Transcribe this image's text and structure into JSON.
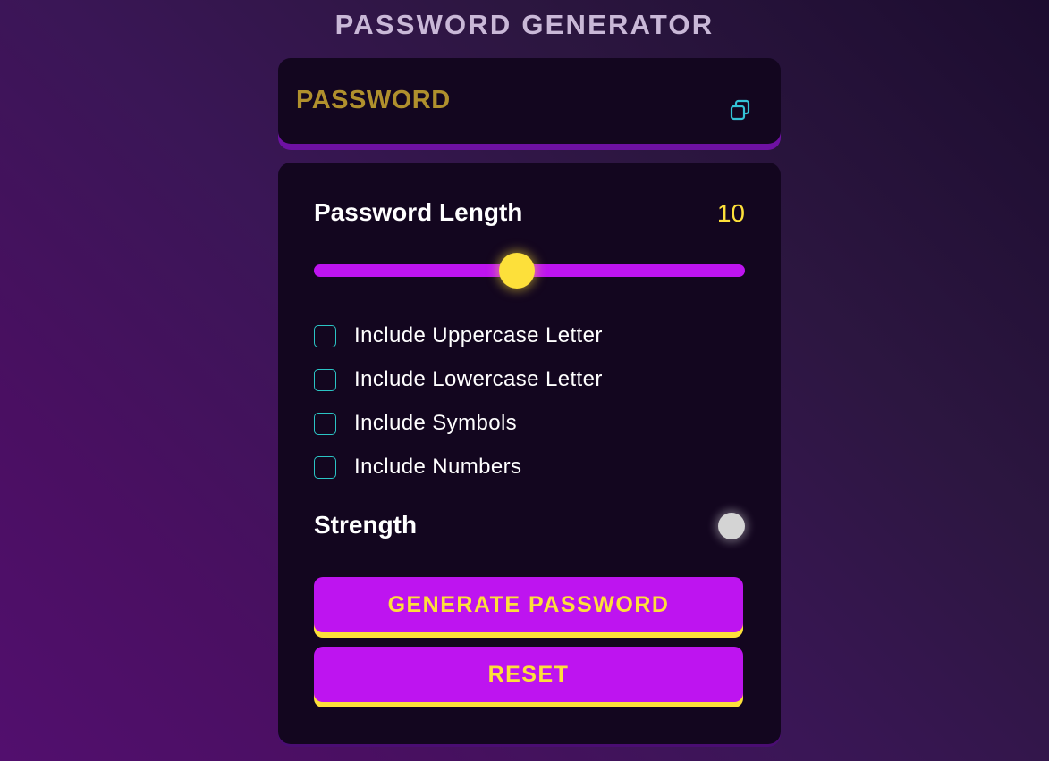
{
  "app": {
    "title": "PASSWORD GENERATOR"
  },
  "display": {
    "password_text": "PASSWORD",
    "copy_icon": "copy-icon"
  },
  "length": {
    "label": "Password Length",
    "value": "10",
    "slider_fraction": 0.47
  },
  "options": [
    {
      "label": "Include Uppercase Letter",
      "checked": false
    },
    {
      "label": "Include Lowercase Letter",
      "checked": false
    },
    {
      "label": "Include Symbols",
      "checked": false
    },
    {
      "label": "Include Numbers",
      "checked": false
    }
  ],
  "strength": {
    "label": "Strength",
    "indicator_color": "#d4d4d4"
  },
  "buttons": {
    "generate": "GENERATE PASSWORD",
    "reset": "RESET"
  },
  "colors": {
    "accent_purple": "#be14f0",
    "accent_yellow": "#fde03a",
    "panel_bg": "#13061f",
    "checkbox_border": "#2bc4c4",
    "password_placeholder": "#b0902d"
  }
}
